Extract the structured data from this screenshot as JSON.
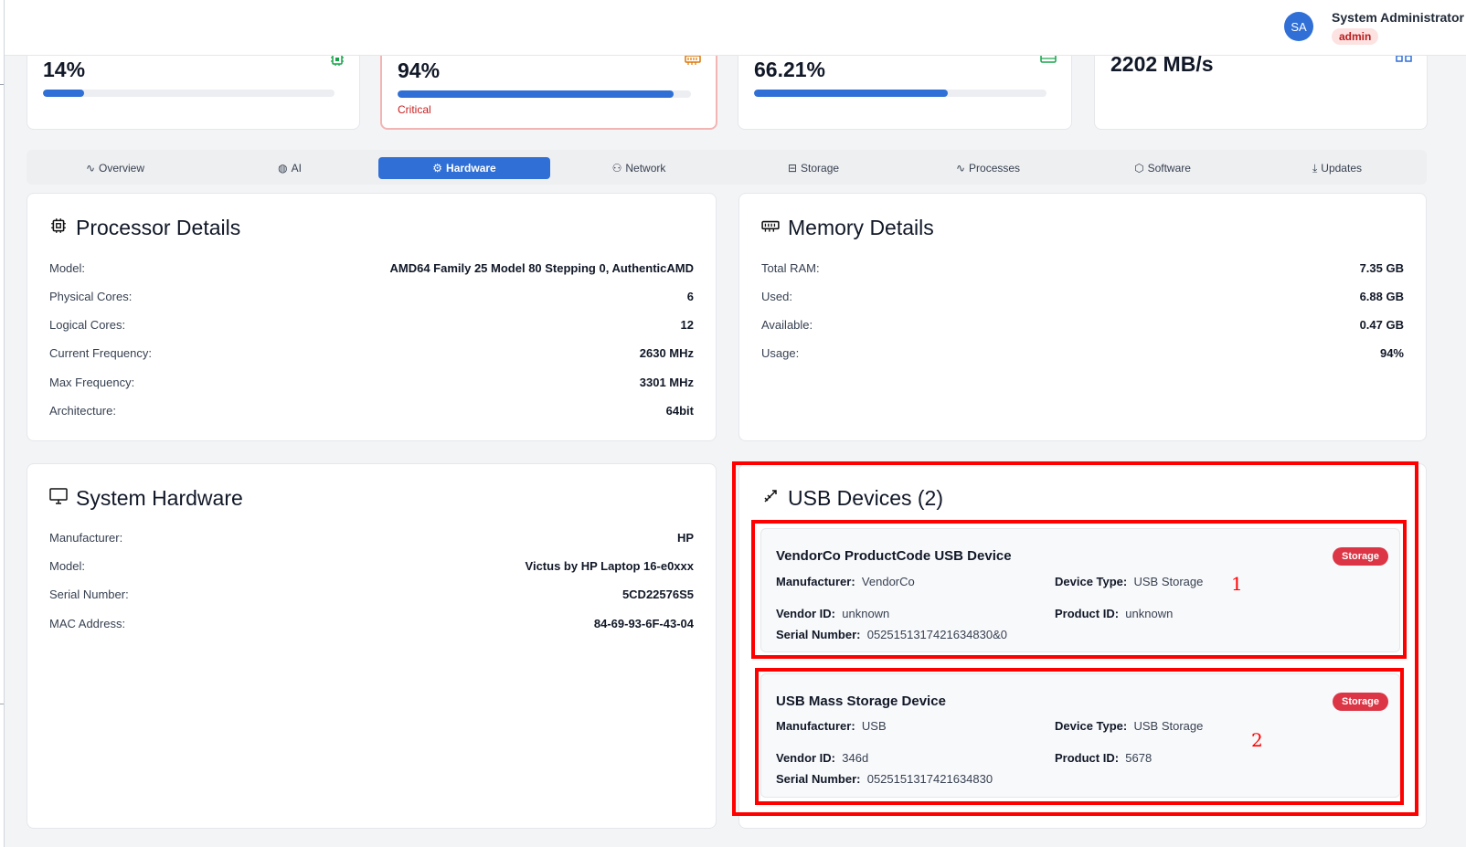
{
  "header": {
    "avatar_initials": "SA",
    "user_name": "System Administrator",
    "user_role": "admin"
  },
  "stats": [
    {
      "value": "14%",
      "progress": 0.14,
      "icon": "cpu-icon",
      "icon_color": "#16a34a"
    },
    {
      "value": "94%",
      "progress": 0.94,
      "icon": "memory-icon",
      "icon_color": "#d97706",
      "note": "Critical"
    },
    {
      "value": "66.21%",
      "progress": 0.6621,
      "icon": "storage-icon",
      "icon_color": "#16a34a"
    },
    {
      "value": "2202 MB/s",
      "icon": "network-icon",
      "icon_color": "#2f6fd6"
    }
  ],
  "tabs": [
    {
      "label": "Overview",
      "icon": "activity-icon"
    },
    {
      "label": "AI",
      "icon": "brain-icon"
    },
    {
      "label": "Hardware",
      "icon": "cpu-icon",
      "active": true
    },
    {
      "label": "Network",
      "icon": "network-icon"
    },
    {
      "label": "Storage",
      "icon": "storage-icon"
    },
    {
      "label": "Processes",
      "icon": "activity-icon"
    },
    {
      "label": "Software",
      "icon": "package-icon"
    },
    {
      "label": "Updates",
      "icon": "download-icon"
    }
  ],
  "processor": {
    "title": "Processor Details",
    "rows": [
      {
        "label": "Model:",
        "value": "AMD64 Family 25 Model 80 Stepping 0, AuthenticAMD"
      },
      {
        "label": "Physical Cores:",
        "value": "6"
      },
      {
        "label": "Logical Cores:",
        "value": "12"
      },
      {
        "label": "Current Frequency:",
        "value": "2630 MHz"
      },
      {
        "label": "Max Frequency:",
        "value": "3301 MHz"
      },
      {
        "label": "Architecture:",
        "value": "64bit"
      }
    ]
  },
  "memory": {
    "title": "Memory Details",
    "rows": [
      {
        "label": "Total RAM:",
        "value": "7.35 GB"
      },
      {
        "label": "Used:",
        "value": "6.88 GB"
      },
      {
        "label": "Available:",
        "value": "0.47 GB"
      },
      {
        "label": "Usage:",
        "value": "94%"
      }
    ]
  },
  "system_hardware": {
    "title": "System Hardware",
    "rows": [
      {
        "label": "Manufacturer:",
        "value": "HP"
      },
      {
        "label": "Model:",
        "value": "Victus by HP Laptop 16-e0xxx"
      },
      {
        "label": "Serial Number:",
        "value": "5CD22576S5"
      },
      {
        "label": "MAC Address:",
        "value": "84-69-93-6F-43-04"
      }
    ]
  },
  "usb": {
    "title": "USB Devices (2)",
    "labels": {
      "manufacturer": "Manufacturer:",
      "device_type": "Device Type:",
      "vendor_id": "Vendor ID:",
      "product_id": "Product ID:",
      "serial": "Serial Number:"
    },
    "devices": [
      {
        "name": "VendorCo ProductCode USB Device",
        "badge": "Storage",
        "manufacturer": "VendorCo",
        "device_type": "USB Storage",
        "vendor_id": "unknown",
        "product_id": "unknown",
        "serial": "0525151317421634830&0"
      },
      {
        "name": "USB Mass Storage Device",
        "badge": "Storage",
        "manufacturer": "USB",
        "device_type": "USB Storage",
        "vendor_id": "346d",
        "product_id": "5678",
        "serial": "0525151317421634830"
      }
    ]
  },
  "annotations": {
    "labels": [
      "1",
      "2"
    ],
    "color": "#ff0000"
  },
  "colors": {
    "accent": "#2f6fd6",
    "critical": "#c81e1e",
    "badge": "#dc3545"
  }
}
